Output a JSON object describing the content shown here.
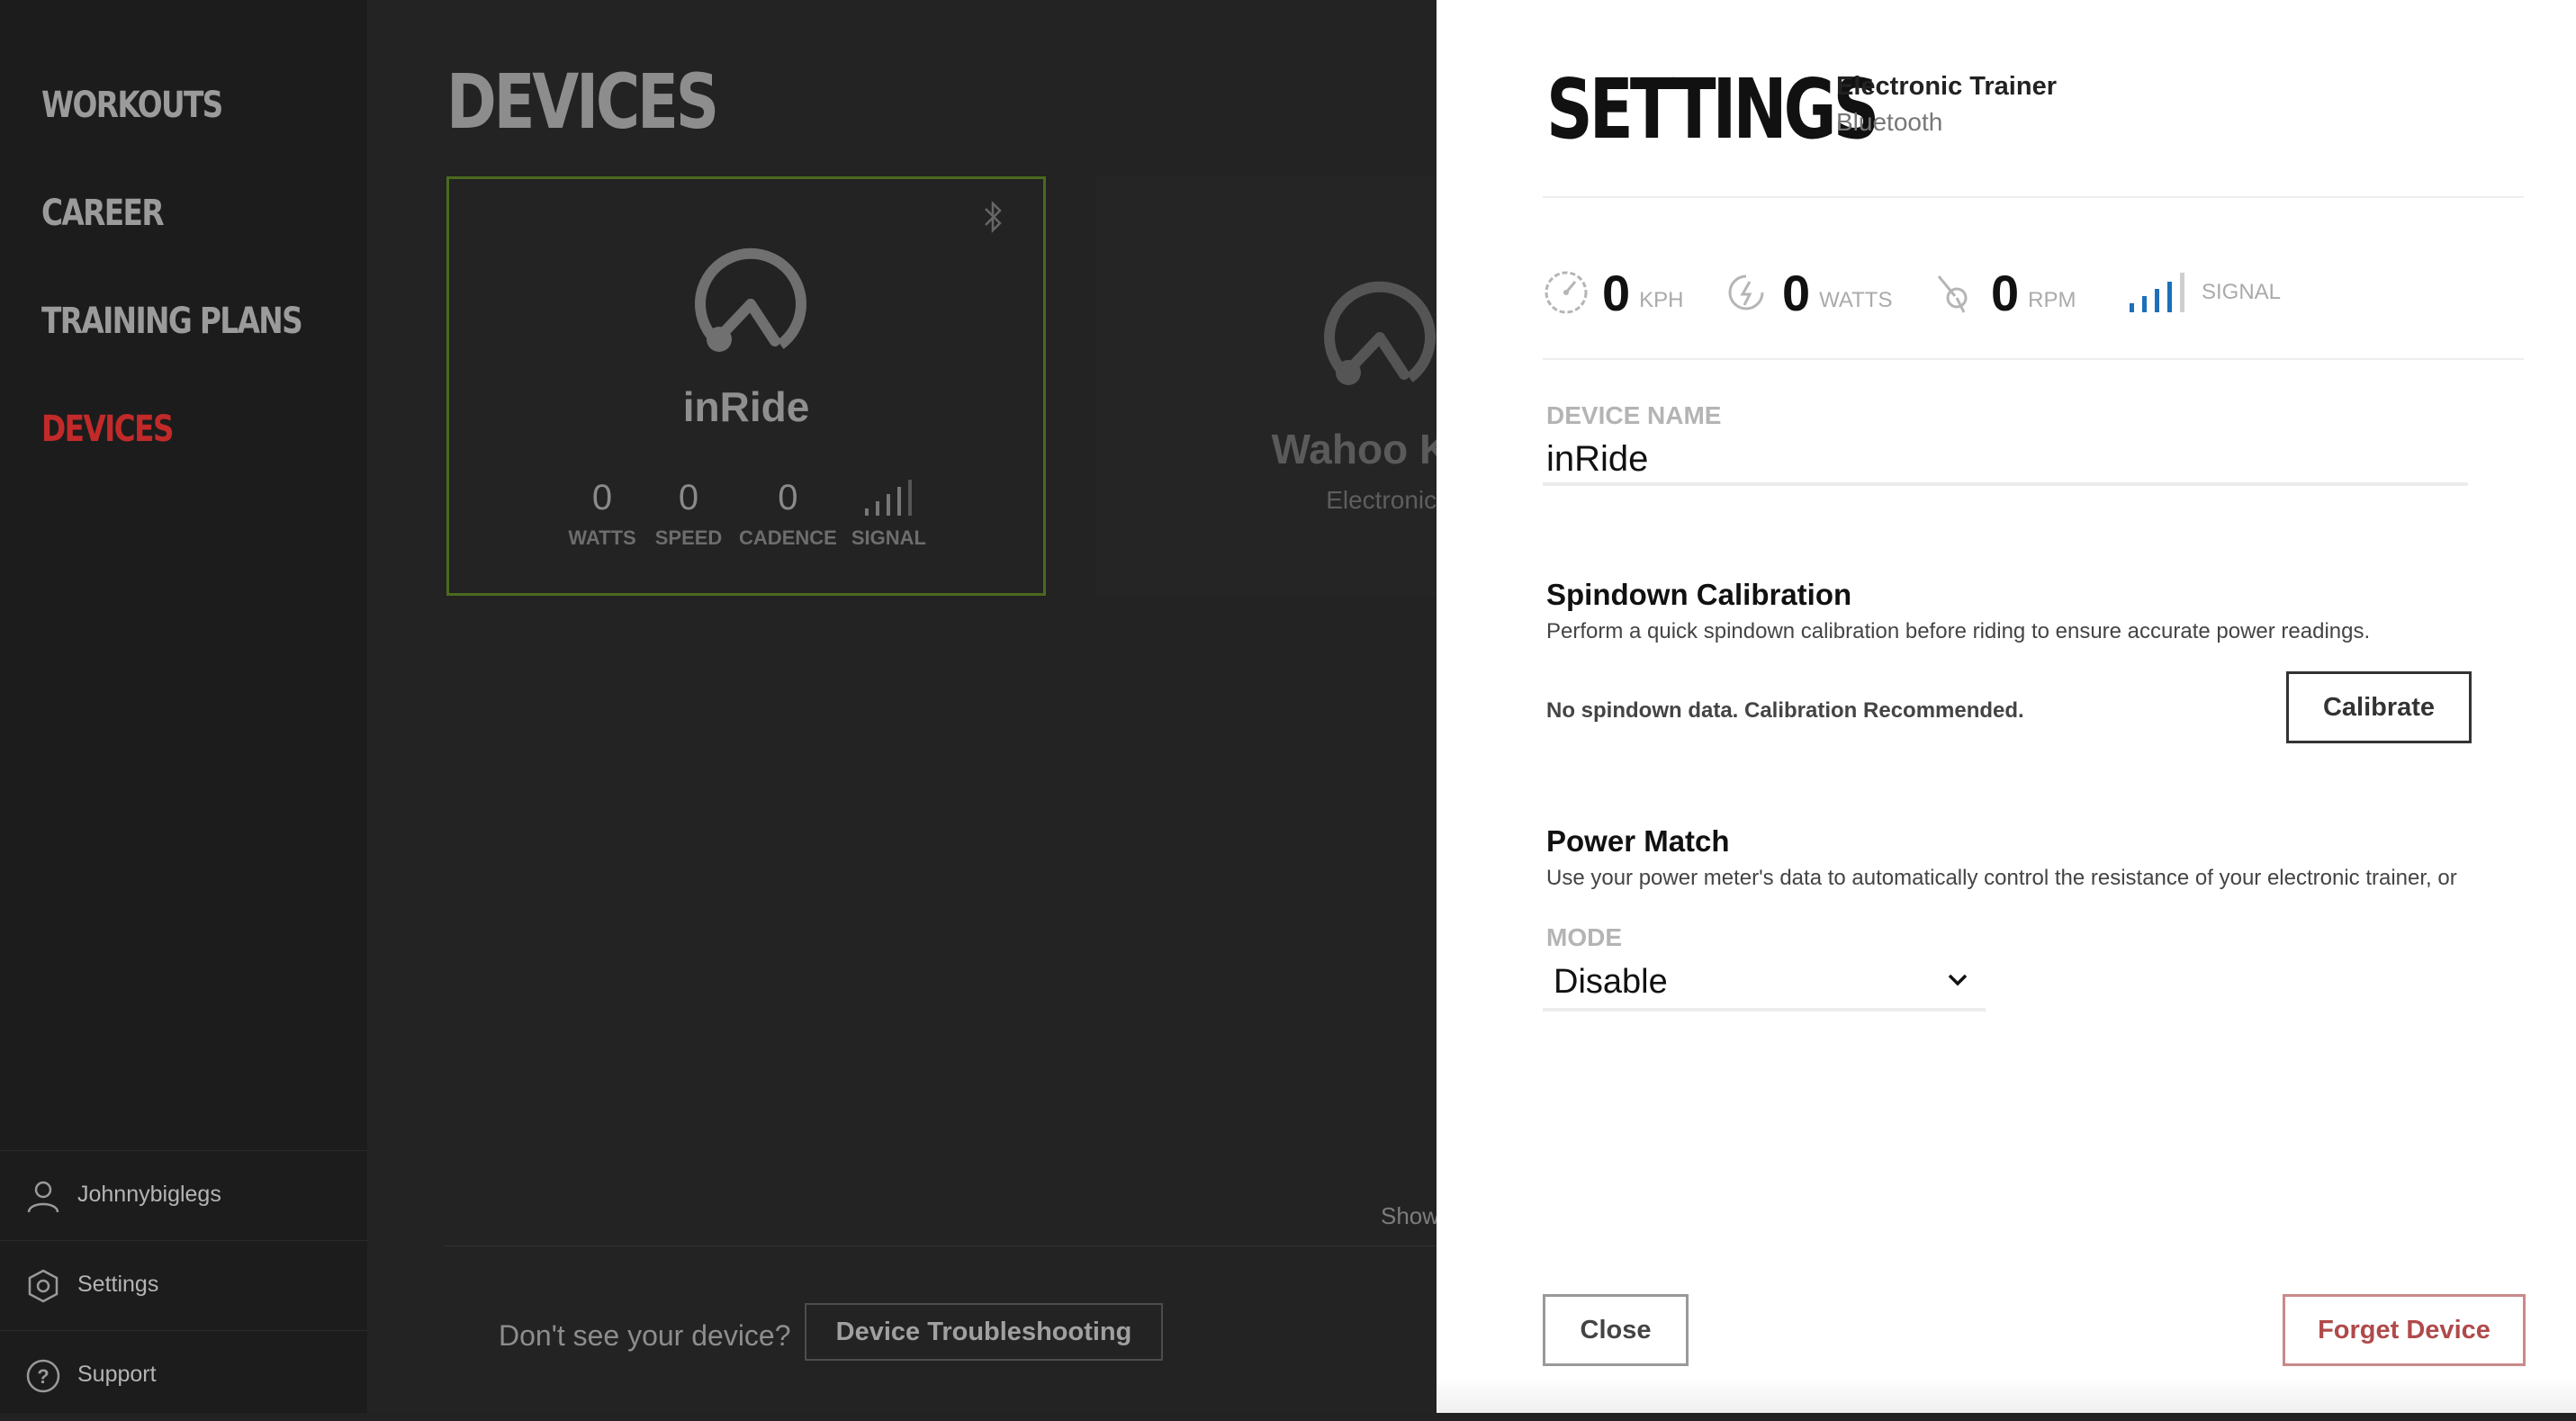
{
  "sidebar": {
    "nav": [
      "WORKOUTS",
      "CAREER",
      "TRAINING PLANS",
      "DEVICES"
    ],
    "active": "DEVICES",
    "account": "Johnnybiglegs",
    "settings": "Settings",
    "support": "Support"
  },
  "main": {
    "title": "DEVICES",
    "devices": [
      {
        "name": "inRide",
        "stats": [
          {
            "value": "0",
            "label": "WATTS"
          },
          {
            "value": "0",
            "label": "SPEED"
          },
          {
            "value": "0",
            "label": "CADENCE"
          },
          {
            "value": "",
            "label": "SIGNAL"
          }
        ]
      },
      {
        "name": "Wahoo KICK",
        "subtitle": "Electronic Tr"
      }
    ],
    "show_text": "Show",
    "dont_see": "Don't see your device?",
    "troubleshoot": "Device Troubleshooting"
  },
  "panel": {
    "title": "SETTINGS",
    "device_type": "Electronic Trainer",
    "connection": "Bluetooth",
    "metrics": [
      {
        "value": "0",
        "unit": "KPH",
        "icon": "speedometer-icon"
      },
      {
        "value": "0",
        "unit": "WATTS",
        "icon": "power-icon"
      },
      {
        "value": "0",
        "unit": "RPM",
        "icon": "cadence-icon"
      },
      {
        "value": "",
        "unit": "SIGNAL",
        "icon": "signal-icon"
      }
    ],
    "device_name_label": "DEVICE NAME",
    "device_name": "inRide",
    "spindown": {
      "title": "Spindown Calibration",
      "desc": "Perform a quick spindown calibration before riding to ensure accurate power readings.",
      "status": "No spindown data. Calibration Recommended.",
      "button": "Calibrate"
    },
    "power_match": {
      "title": "Power Match",
      "desc": "Use your power meter's data to automatically control the resistance of your electronic trainer, or",
      "mode_label": "MODE",
      "mode_value": "Disable"
    },
    "close": "Close",
    "forget": "Forget Device"
  },
  "colors": {
    "active_nav": "#c22a2a",
    "signal_blue": "#1d6fb8",
    "selected_border": "#4a6a1e",
    "forget": "#b04a4a"
  }
}
